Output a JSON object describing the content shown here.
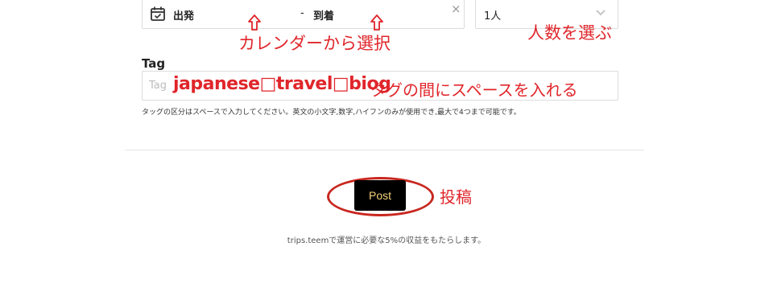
{
  "date_field": {
    "depart_label": "出発",
    "separator": "-",
    "arrive_label": "到着",
    "clear_symbol": "×"
  },
  "people_select": {
    "selected": "1人"
  },
  "annotations": {
    "calendar": "カレンダーから選択",
    "people": "人数を選ぶ",
    "tag_spacing": "タグの間にスペースを入れる",
    "post": "投稿",
    "color": "#e0262b"
  },
  "tag_field": {
    "label": "Tag",
    "placeholder": "Tag",
    "value": "japanese□travel□biog",
    "hint": "タッグの区分はスペースで入力してください。英文の小文字,数字,ハイフンのみが使用でき,最大で4つまで可能です。"
  },
  "post_button": {
    "label": "Post",
    "text_color": "#f3d27a",
    "bg_color": "#000000"
  },
  "footer": {
    "text": "trips.teemで運営に必要な5%の収益をもたらします。"
  }
}
